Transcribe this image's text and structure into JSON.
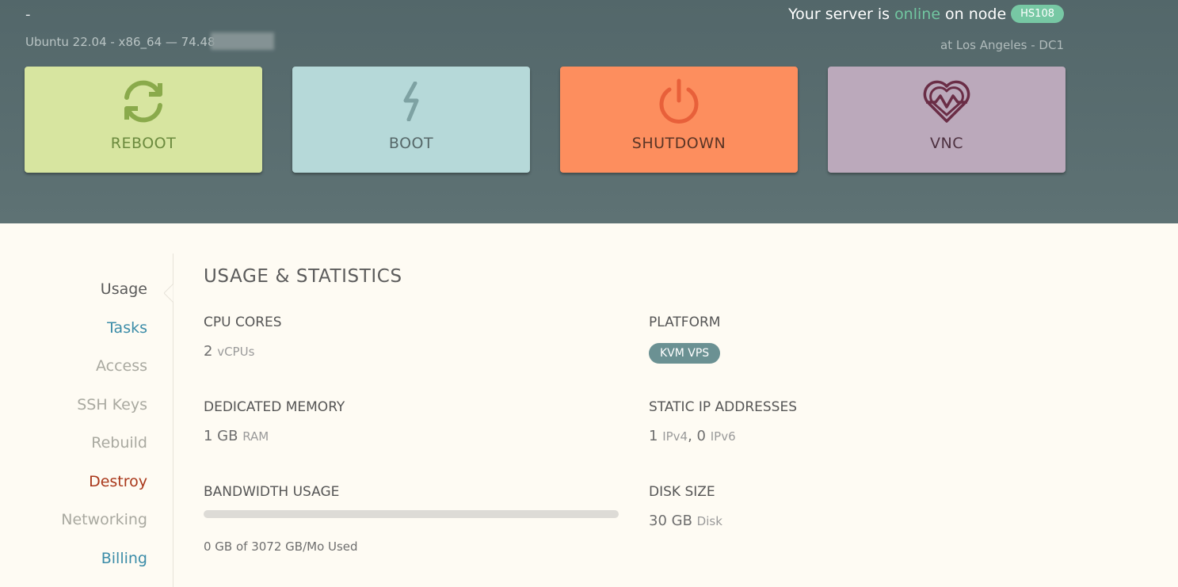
{
  "header": {
    "server_name": "-",
    "os_line": "Ubuntu 22.04 - x86_64 — 74.48",
    "status_prefix": "Your server is",
    "status_value": "online",
    "status_suffix": "on node",
    "node": "HS108",
    "location": "at Los Angeles - DC1"
  },
  "actions": [
    {
      "label": "REBOOT",
      "icon": "refresh-icon"
    },
    {
      "label": "BOOT",
      "icon": "lightning-icon"
    },
    {
      "label": "SHUTDOWN",
      "icon": "power-icon"
    },
    {
      "label": "VNC",
      "icon": "heart-pulse-icon"
    }
  ],
  "sidebar": {
    "items": [
      "Usage",
      "Tasks",
      "Access",
      "SSH Keys",
      "Rebuild",
      "Destroy",
      "Networking",
      "Billing"
    ],
    "active": "Usage"
  },
  "main": {
    "title": "USAGE & STATISTICS",
    "cpu": {
      "label": "CPU CORES",
      "value": "2",
      "unit": "vCPUs"
    },
    "platform": {
      "label": "PLATFORM",
      "value": "KVM VPS"
    },
    "memory": {
      "label": "DEDICATED MEMORY",
      "value": "1 GB",
      "unit": "RAM"
    },
    "ips": {
      "label": "STATIC IP ADDRESSES",
      "v4_count": "1",
      "v4_unit": "IPv4",
      "sep": ",",
      "v6_count": "0",
      "v6_unit": "IPv6"
    },
    "bandwidth": {
      "label": "BANDWIDTH USAGE",
      "used_fraction": 0,
      "text": "0 GB of 3072 GB/Mo Used"
    },
    "disk": {
      "label": "DISK SIZE",
      "value": "30 GB",
      "unit": "Disk"
    }
  },
  "colors": {
    "header_bg": "#5a6e70",
    "online": "#71c6a0",
    "reboot_bg": "#d7e5a0",
    "boot_bg": "#b6d9d9",
    "shutdown_bg": "#fd8e5e",
    "vnc_bg": "#bba9bb",
    "link": "#3b8ca8",
    "danger": "#a9371a"
  }
}
